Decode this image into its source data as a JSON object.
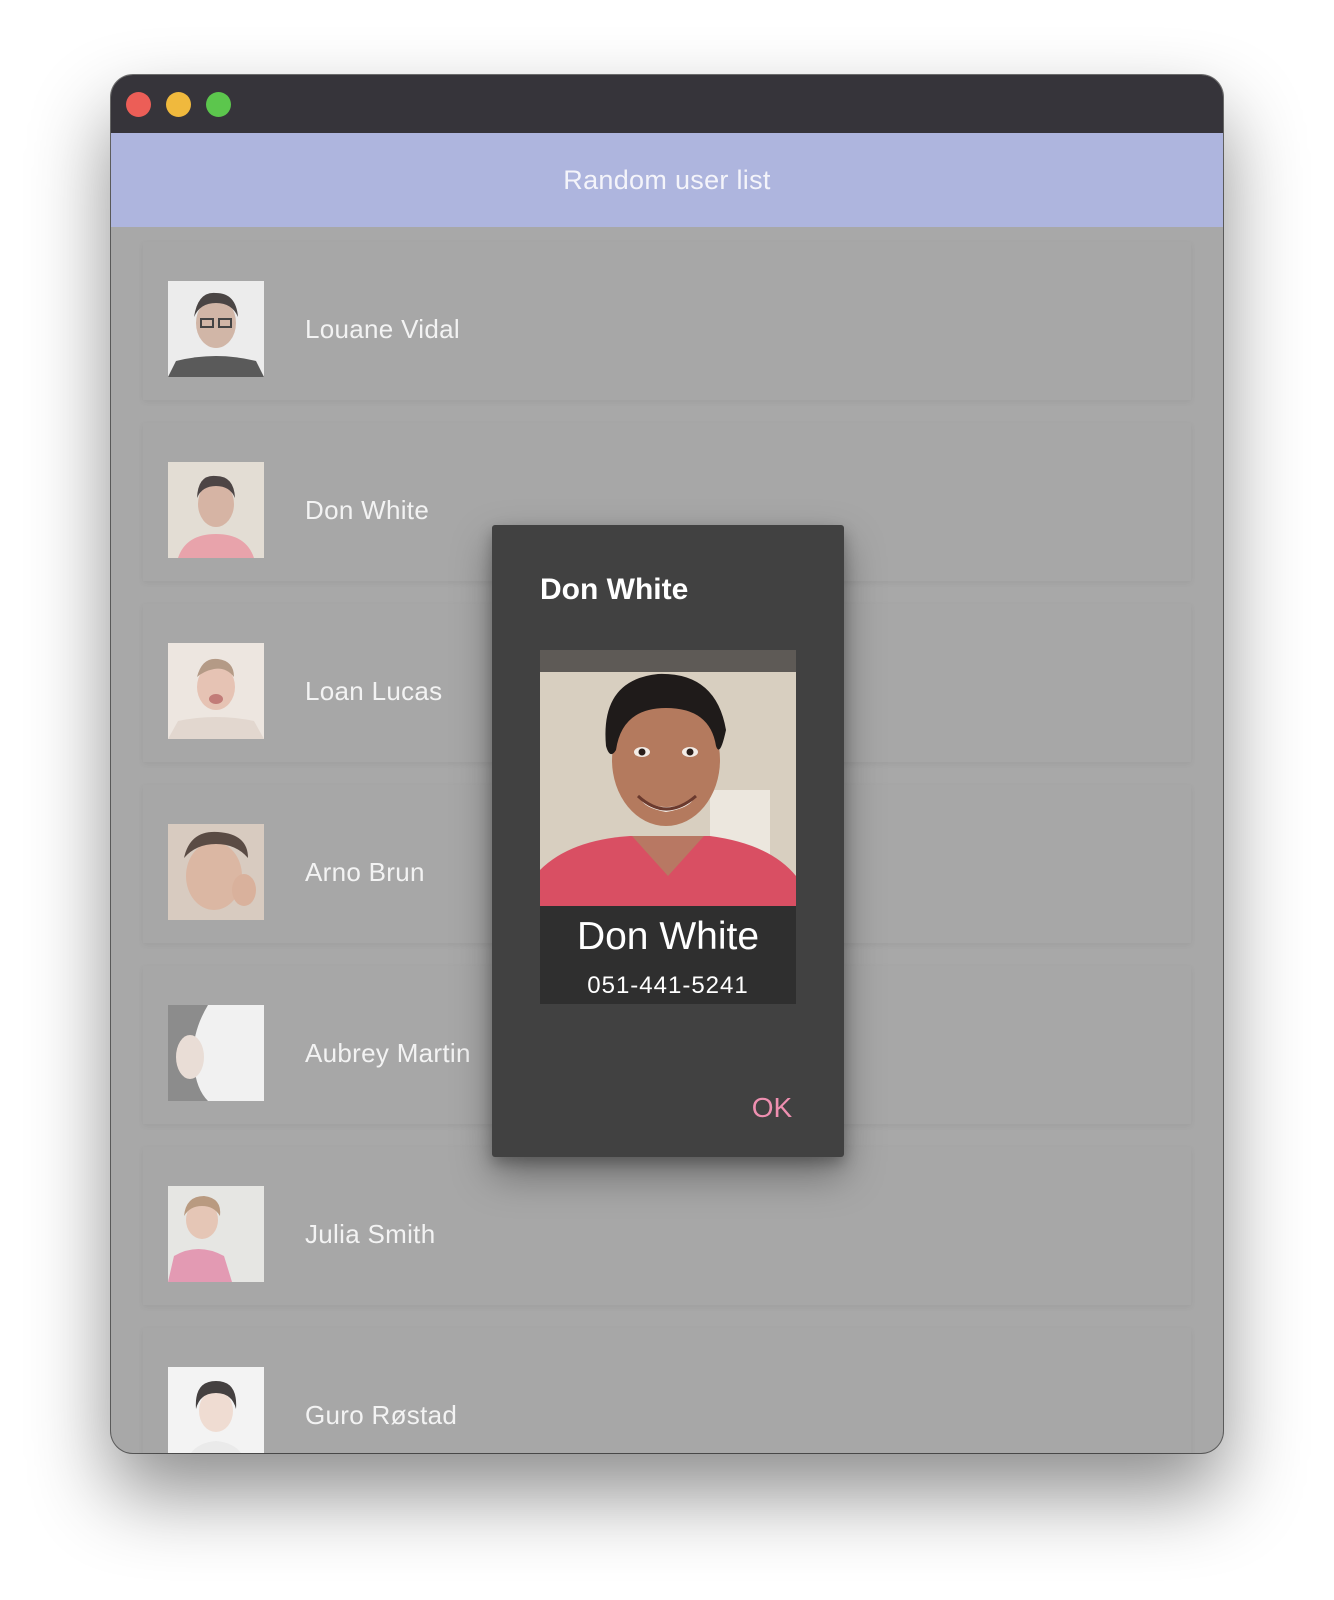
{
  "appbar": {
    "title": "Random user list"
  },
  "users": [
    {
      "name": "Louane Vidal"
    },
    {
      "name": "Don White"
    },
    {
      "name": "Loan Lucas"
    },
    {
      "name": "Arno Brun"
    },
    {
      "name": "Aubrey Martin"
    },
    {
      "name": "Julia Smith"
    },
    {
      "name": "Guro Røstad"
    }
  ],
  "dialog": {
    "title": "Don White",
    "card_name": "Don White",
    "card_phone": "051-441-5241",
    "ok_label": "OK"
  },
  "colors": {
    "titlebar": "#36343a",
    "appbar": "#aeb5de",
    "overlay": "#a8a8a8",
    "dialog": "#414141",
    "accent": "#ee8fb0"
  }
}
